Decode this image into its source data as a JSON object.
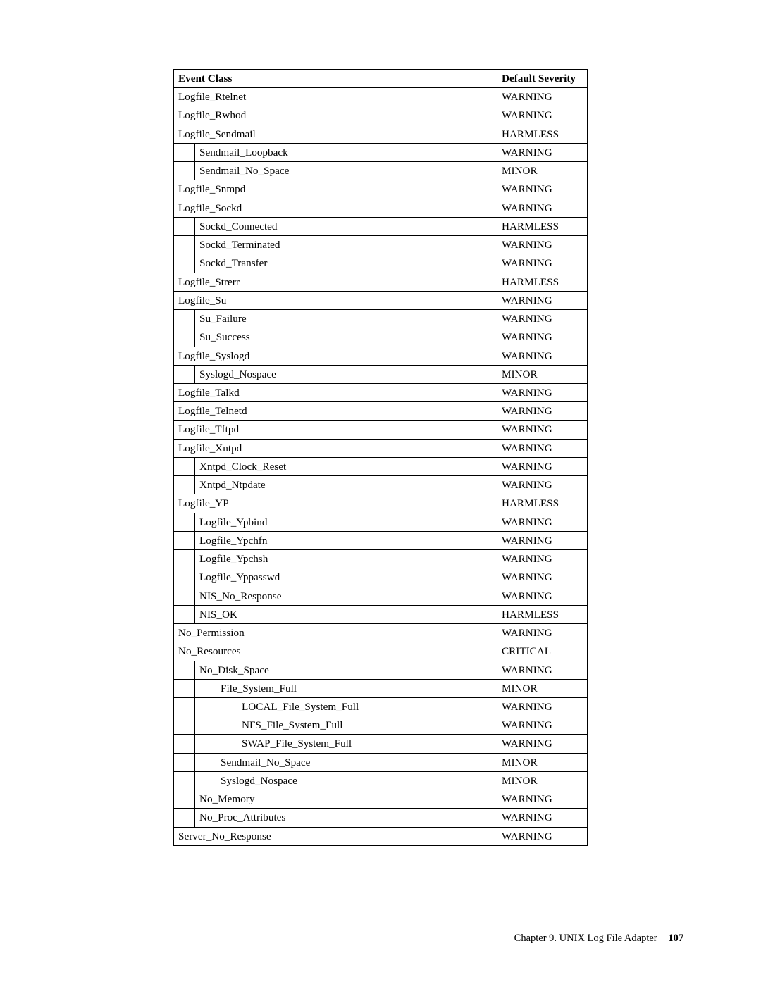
{
  "headers": {
    "event": "Event Class",
    "severity": "Default Severity"
  },
  "rows": [
    {
      "indent": 0,
      "name": "Logfile_Rtelnet",
      "sev": "WARNING"
    },
    {
      "indent": 0,
      "name": "Logfile_Rwhod",
      "sev": "WARNING"
    },
    {
      "indent": 0,
      "name": "Logfile_Sendmail",
      "sev": "HARMLESS"
    },
    {
      "indent": 1,
      "name": "Sendmail_Loopback",
      "sev": "WARNING"
    },
    {
      "indent": 1,
      "name": "Sendmail_No_Space",
      "sev": "MINOR"
    },
    {
      "indent": 0,
      "name": "Logfile_Snmpd",
      "sev": "WARNING"
    },
    {
      "indent": 0,
      "name": "Logfile_Sockd",
      "sev": "WARNING"
    },
    {
      "indent": 1,
      "name": "Sockd_Connected",
      "sev": "HARMLESS"
    },
    {
      "indent": 1,
      "name": "Sockd_Terminated",
      "sev": "WARNING"
    },
    {
      "indent": 1,
      "name": "Sockd_Transfer",
      "sev": "WARNING"
    },
    {
      "indent": 0,
      "name": "Logfile_Strerr",
      "sev": "HARMLESS"
    },
    {
      "indent": 0,
      "name": "Logfile_Su",
      "sev": "WARNING"
    },
    {
      "indent": 1,
      "name": "Su_Failure",
      "sev": "WARNING"
    },
    {
      "indent": 1,
      "name": "Su_Success",
      "sev": "WARNING"
    },
    {
      "indent": 0,
      "name": "Logfile_Syslogd",
      "sev": "WARNING"
    },
    {
      "indent": 1,
      "name": "Syslogd_Nospace",
      "sev": "MINOR"
    },
    {
      "indent": 0,
      "name": "Logfile_Talkd",
      "sev": "WARNING"
    },
    {
      "indent": 0,
      "name": "Logfile_Telnetd",
      "sev": "WARNING"
    },
    {
      "indent": 0,
      "name": "Logfile_Tftpd",
      "sev": "WARNING"
    },
    {
      "indent": 0,
      "name": "Logfile_Xntpd",
      "sev": "WARNING"
    },
    {
      "indent": 1,
      "name": "Xntpd_Clock_Reset",
      "sev": "WARNING"
    },
    {
      "indent": 1,
      "name": "Xntpd_Ntpdate",
      "sev": "WARNING"
    },
    {
      "indent": 0,
      "name": "Logfile_YP",
      "sev": "HARMLESS"
    },
    {
      "indent": 1,
      "name": "Logfile_Ypbind",
      "sev": "WARNING"
    },
    {
      "indent": 1,
      "name": "Logfile_Ypchfn",
      "sev": "WARNING"
    },
    {
      "indent": 1,
      "name": "Logfile_Ypchsh",
      "sev": "WARNING"
    },
    {
      "indent": 1,
      "name": "Logfile_Yppasswd",
      "sev": "WARNING"
    },
    {
      "indent": 1,
      "name": "NIS_No_Response",
      "sev": "WARNING"
    },
    {
      "indent": 1,
      "name": "NIS_OK",
      "sev": "HARMLESS"
    },
    {
      "indent": 0,
      "name": "No_Permission",
      "sev": "WARNING"
    },
    {
      "indent": 0,
      "name": "No_Resources",
      "sev": "CRITICAL"
    },
    {
      "indent": 1,
      "name": "No_Disk_Space",
      "sev": "WARNING"
    },
    {
      "indent": 2,
      "name": "File_System_Full",
      "sev": "MINOR"
    },
    {
      "indent": 3,
      "name": "LOCAL_File_System_Full",
      "sev": "WARNING"
    },
    {
      "indent": 3,
      "name": "NFS_File_System_Full",
      "sev": "WARNING"
    },
    {
      "indent": 3,
      "name": "SWAP_File_System_Full",
      "sev": "WARNING"
    },
    {
      "indent": 2,
      "name": "Sendmail_No_Space",
      "sev": "MINOR"
    },
    {
      "indent": 2,
      "name": "Syslogd_Nospace",
      "sev": "MINOR"
    },
    {
      "indent": 1,
      "name": "No_Memory",
      "sev": "WARNING"
    },
    {
      "indent": 1,
      "name": "No_Proc_Attributes",
      "sev": "WARNING"
    },
    {
      "indent": 0,
      "name": "Server_No_Response",
      "sev": "WARNING"
    }
  ],
  "footer": {
    "chapter": "Chapter 9. UNIX Log File Adapter",
    "page": "107"
  }
}
